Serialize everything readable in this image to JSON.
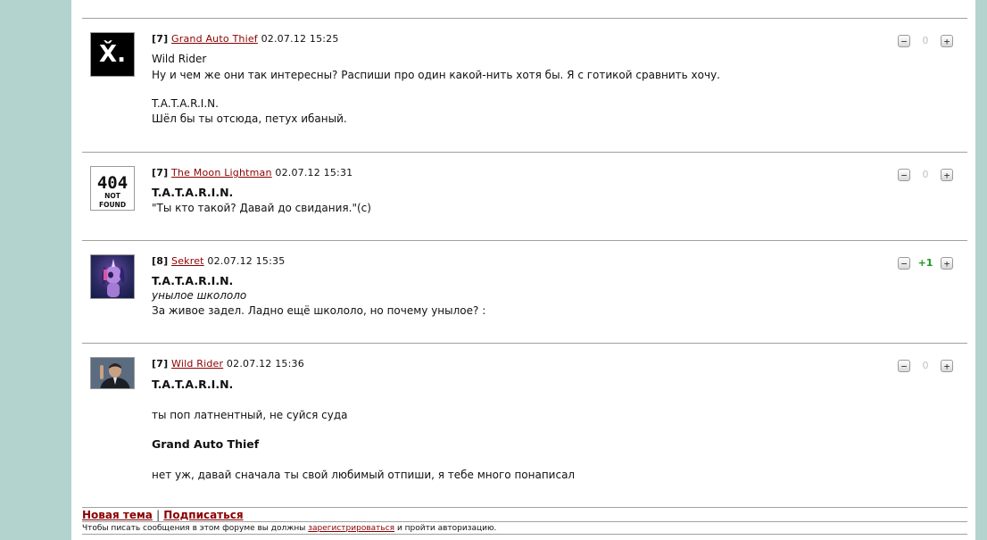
{
  "posts": [
    {
      "rank": "[7]",
      "author": "Grand Auto Thief",
      "date": "02.07.12 15:25",
      "lines": [
        "Wild Rider",
        "Ну и чем же они так интересны? Распиши про один какой-нить хотя бы. Я с готикой сравнить хочу.",
        "T.A.T.A.R.I.N.",
        "Шёл бы ты отсюда, петух ибаный."
      ],
      "score": "0",
      "avatar_text": "X̌."
    },
    {
      "rank": "[7]",
      "author": "The Moon Lightman",
      "date": "02.07.12 15:31",
      "lines": [
        "T.A.T.A.R.I.N.",
        "\"Ты кто такой? Давай до свидания.\"(c)"
      ],
      "score": "0",
      "avatar_text": "404",
      "avatar_sub": "NOT FOUND"
    },
    {
      "rank": "[8]",
      "author": "Sekret",
      "date": "02.07.12 15:35",
      "lines": [
        "T.A.T.A.R.I.N.",
        "унылое школоло",
        "За живое задел. Ладно ещё школоло, но почему унылое? :"
      ],
      "score": "+1"
    },
    {
      "rank": "[7]",
      "author": "Wild Rider",
      "date": "02.07.12 15:36",
      "lines": [
        "T.A.T.A.R.I.N.",
        "ты поп латнентный, не суйся суда",
        "Grand Auto Thief",
        "нет уж, давай сначала ты свой любимый отпиши, я тебе много понаписал"
      ],
      "score": "0"
    }
  ],
  "vote": {
    "minus": "−",
    "plus": "+"
  },
  "footer": {
    "new_topic": "Новая тема",
    "separator": "|",
    "subscribe": "Подписаться",
    "note_before": "Чтобы писать сообщения в этом форуме вы должны",
    "note_link": "зарегистрироваться",
    "note_after": "и пройти авторизацию."
  },
  "colors": {
    "background": "#b3d3ce",
    "link": "#8b0000",
    "positive": "#1a9a1a"
  }
}
